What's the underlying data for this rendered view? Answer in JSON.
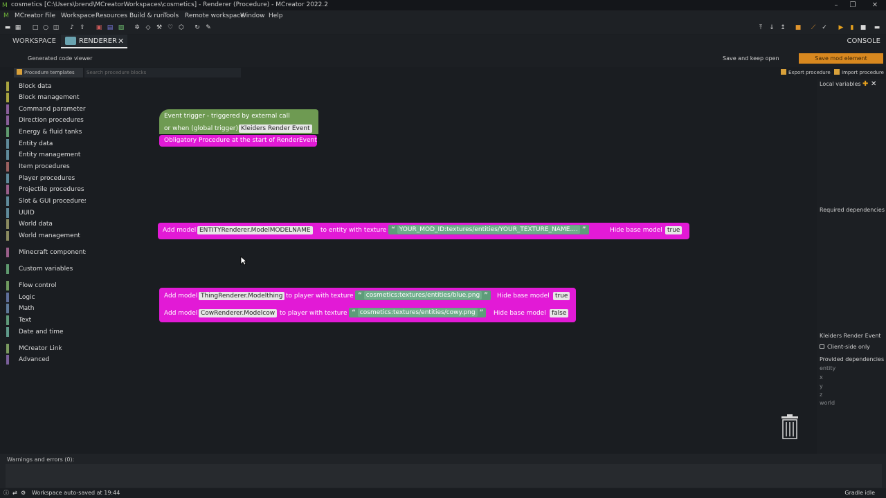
{
  "window": {
    "title": "cosmetics [C:\\Users\\brend\\MCreatorWorkspaces\\cosmetics] - Renderer (Procedure) - MCreator 2022.2"
  },
  "menu": [
    "MCreator",
    "File",
    "Workspace",
    "Resources",
    "Build & run",
    "Tools",
    "Remote workspace",
    "Window",
    "Help"
  ],
  "tabs": {
    "workspace": "WORKSPACE",
    "renderer": "RENDERER",
    "console": "CONSOLE"
  },
  "editor": {
    "generated_code_viewer": "Generated code viewer",
    "save_keep_open": "Save and keep open",
    "save_mod_element": "Save mod element",
    "procedure_templates": "Procedure templates",
    "search_placeholder": "Search procedure blocks",
    "export_procedure": "Export procedure",
    "import_procedure": "Import procedure"
  },
  "categories": [
    {
      "label": "Block data",
      "color": "#a8a43f"
    },
    {
      "label": "Block management",
      "color": "#a8a43f"
    },
    {
      "label": "Command parameters",
      "color": "#8a5f9a"
    },
    {
      "label": "Direction procedures",
      "color": "#8a5f9a"
    },
    {
      "label": "Energy & fluid tanks",
      "color": "#5f9a6f"
    },
    {
      "label": "Entity data",
      "color": "#5f8a9a"
    },
    {
      "label": "Entity management",
      "color": "#5f8a9a"
    },
    {
      "label": "Item procedures",
      "color": "#9a5f5f"
    },
    {
      "label": "Player procedures",
      "color": "#5f8a9a"
    },
    {
      "label": "Projectile procedures",
      "color": "#9a5f8a"
    },
    {
      "label": "Slot & GUI procedures",
      "color": "#5f8a9a"
    },
    {
      "label": "UUID",
      "color": "#5f8a9a"
    },
    {
      "label": "World data",
      "color": "#8a8a5f"
    },
    {
      "label": "World management",
      "color": "#8a8a5f"
    },
    {
      "label": "Minecraft components",
      "color": "#9a5f8a"
    },
    {
      "label": "Custom variables",
      "color": "#5f9a6f"
    },
    {
      "label": "Flow control",
      "color": "#6f9a5f"
    },
    {
      "label": "Logic",
      "color": "#5f6f9a"
    },
    {
      "label": "Math",
      "color": "#5f7a9a"
    },
    {
      "label": "Text",
      "color": "#5f9a7a"
    },
    {
      "label": "Date and time",
      "color": "#5f9a8a"
    },
    {
      "label": "MCreator Link",
      "color": "#7a9a5f"
    },
    {
      "label": "Advanced",
      "color": "#7a5f9a"
    }
  ],
  "blocks": {
    "trigger": {
      "line1": "Event trigger - triggered by external call",
      "line2_prefix": "or when (global trigger)",
      "event": "Kleiders Render Event",
      "obligatory": "Obligatory Procedure at the start of RenderEvent"
    },
    "entity_model": {
      "add_model": "Add model",
      "model": "ENTITYRenderer.ModelMODELNAME",
      "to_text": "to entity with texture",
      "texture": "YOUR_MOD_ID:textures/entities/YOUR_TEXTURE_NAME....",
      "hide": "Hide base model",
      "value": "true"
    },
    "player_model_1": {
      "add_model": "Add model",
      "model": "ThingRenderer.Modelthing",
      "to_text": "to player with texture",
      "texture": "cosmetics:textures/entities/blue.png",
      "hide": "Hide base model",
      "value": "true"
    },
    "player_model_2": {
      "add_model": "Add model",
      "model": "CowRenderer.Modelcow",
      "to_text": "to player with texture",
      "texture": "cosmetics:textures/entities/cowy.png",
      "hide": "Hide base model",
      "value": "false"
    }
  },
  "right_panel": {
    "local_variables": "Local variables",
    "required_dependencies": "Required dependencies",
    "trigger_name": "Kleiders Render Event",
    "client_side_only": "Client-side only",
    "provided_dependencies": "Provided dependencies",
    "deps": [
      "entity",
      "x",
      "y",
      "z",
      "world"
    ]
  },
  "warnings": "Warnings and errors (0):",
  "status": {
    "left": "Workspace auto-saved at 19:44",
    "right": "Gradle idle"
  }
}
